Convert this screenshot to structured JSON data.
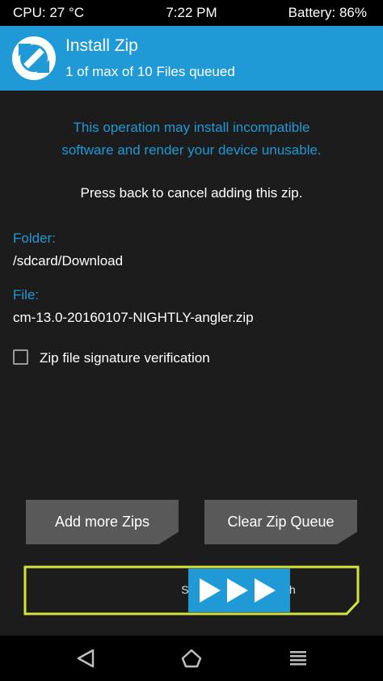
{
  "status_bar": {
    "cpu": "CPU: 27 °C",
    "time": "7:22 PM",
    "battery": "Battery: 86%"
  },
  "header": {
    "title": "Install Zip",
    "subtitle": "1 of max of 10 Files queued",
    "logo_icon": "twrp-logo-icon"
  },
  "warning": {
    "line1": "This operation may install incompatible",
    "line2": "software and render your device unusable."
  },
  "instruction": "Press back to cancel adding this zip.",
  "folder": {
    "label": "Folder:",
    "value": "/sdcard/Download"
  },
  "file": {
    "label": "File:",
    "value": "cm-13.0-20160107-NIGHTLY-angler.zip"
  },
  "signature_verification": {
    "label": "Zip file signature verification",
    "checked": false
  },
  "buttons": {
    "add_more": "Add more Zips",
    "clear_queue": "Clear Zip Queue"
  },
  "swipe": {
    "label": "Swipe to confirm Flash"
  },
  "nav": {
    "back_icon": "back-triangle-icon",
    "home_icon": "home-icon",
    "menu_icon": "menu-icon"
  },
  "colors": {
    "accent": "#1f9ad6",
    "background": "#1c1c1c",
    "button": "#595959",
    "swipe_frame": "#d6e33a"
  }
}
